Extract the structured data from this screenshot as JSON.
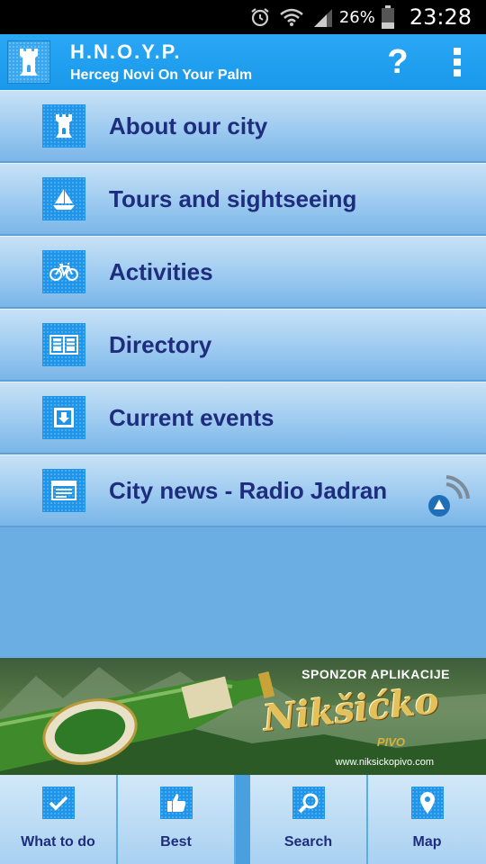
{
  "status_bar": {
    "battery_percent": "26%",
    "time": "23:28",
    "icons": [
      "alarm-icon",
      "wifi-icon",
      "signal-icon",
      "battery-icon"
    ]
  },
  "app_bar": {
    "title": "H.N.O.Y.P.",
    "subtitle": "Herceg Novi On Your Palm",
    "help_label": "?",
    "logo_icon": "tower-icon",
    "accent_color": "#1a98ea"
  },
  "menu": {
    "items": [
      {
        "label": "About our city",
        "icon": "tower-icon"
      },
      {
        "label": "Tours and sightseeing",
        "icon": "sailboat-icon"
      },
      {
        "label": "Activities",
        "icon": "bicycle-icon"
      },
      {
        "label": "Directory",
        "icon": "book-icon"
      },
      {
        "label": "Current events",
        "icon": "download-icon"
      },
      {
        "label": "City news - Radio Jadran",
        "icon": "news-icon"
      }
    ]
  },
  "ad_banner": {
    "sponsor_text": "SPONZOR APLIKACIJE",
    "brand": "Nikšićko",
    "sub_brand": "PIVO",
    "url": "www.niksickopivo.com"
  },
  "bottom_nav": {
    "items": [
      {
        "label": "What to do",
        "icon": "checkmark-icon"
      },
      {
        "label": "Best",
        "icon": "thumbs-up-icon"
      },
      {
        "label": "Search",
        "icon": "magnifier-icon"
      },
      {
        "label": "Map",
        "icon": "map-pin-icon"
      }
    ]
  }
}
